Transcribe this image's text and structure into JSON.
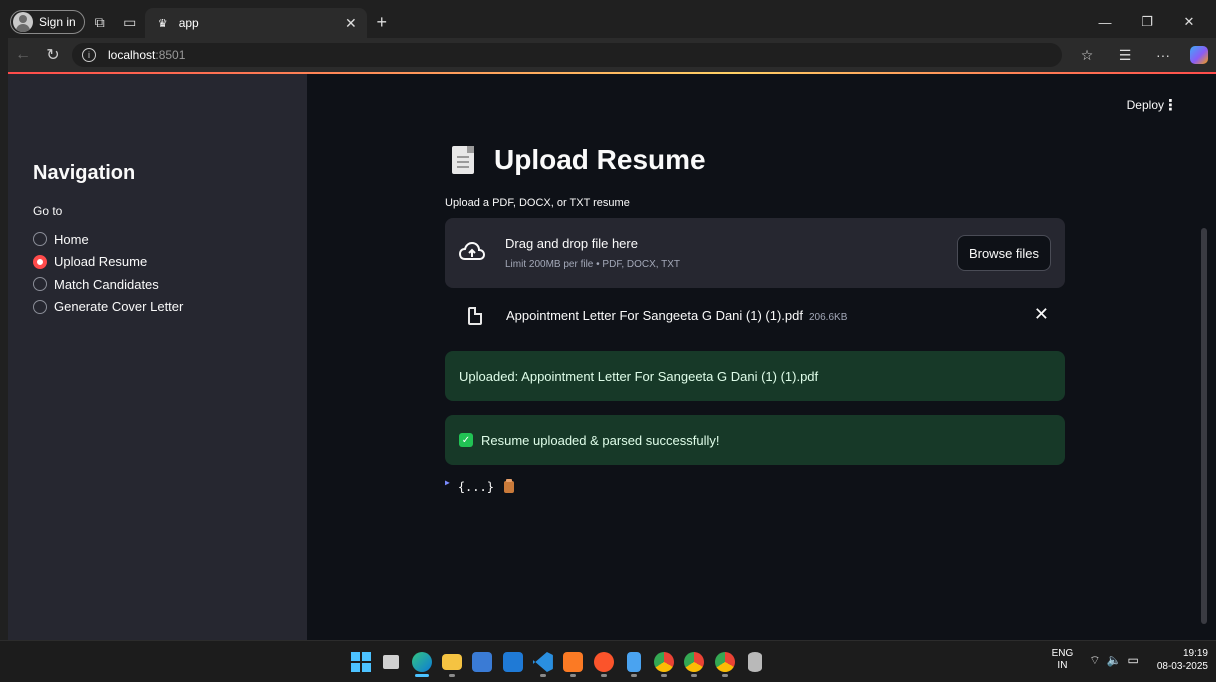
{
  "browser": {
    "signin_label": "Sign in",
    "tab_title": "app",
    "tab_favicon": "streamlit-crown-icon",
    "url_host": "localhost",
    "url_port": ":8501"
  },
  "app": {
    "deploy_label": "Deploy",
    "sidebar": {
      "title": "Navigation",
      "radio_label": "Go to",
      "options": [
        "Home",
        "Upload Resume",
        "Match Candidates",
        "Generate Cover Letter"
      ],
      "selected": "Upload Resume"
    },
    "main": {
      "title": "Upload Resume",
      "uploader": {
        "label": "Upload a PDF, DOCX, or TXT resume",
        "drop_text": "Drag and drop file here",
        "limit_text": "Limit 200MB per file • PDF, DOCX, TXT",
        "browse_label": "Browse files"
      },
      "file": {
        "name": "Appointment Letter For Sangeeta G Dani (1) (1).pdf",
        "size": "206.6KB"
      },
      "alert_uploaded": "Uploaded: Appointment Letter For Sangeeta G Dani (1) (1).pdf",
      "alert_success": "Resume uploaded & parsed successfully!",
      "json_collapsed": "{...}"
    }
  },
  "taskbar": {
    "lang_top": "ENG",
    "lang_bottom": "IN",
    "time": "19:19",
    "date": "08-03-2025",
    "apps": [
      "start",
      "task-view",
      "edge",
      "file-explorer",
      "store",
      "outlook",
      "vscode",
      "xampp",
      "brave",
      "notepad",
      "chrome",
      "chrome-profile",
      "chrome-profile-2",
      "database"
    ]
  },
  "colors": {
    "accent": "#ff4b4b",
    "success_bg": "#173928",
    "sidebar_bg": "#262730",
    "main_bg": "#0e1117"
  }
}
